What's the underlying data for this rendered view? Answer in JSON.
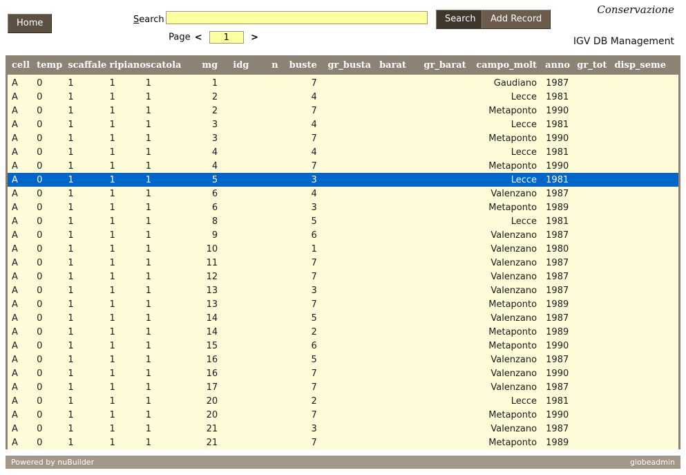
{
  "toolbar": {
    "home_label": "Home",
    "search_label_prefix": "S",
    "search_label_rest": "earch",
    "search_value": "",
    "search_placeholder": "",
    "search_button_label": "Search",
    "add_record_button_label": "Add Record"
  },
  "titles": {
    "app_title": "Conservazione",
    "subtitle": "IGV DB Management"
  },
  "pager": {
    "label": "Page",
    "prev_arrow": "<",
    "next_arrow": ">",
    "page_value": "1"
  },
  "table": {
    "columns": [
      {
        "key": "cell",
        "label": "cell",
        "align": "left"
      },
      {
        "key": "temp",
        "label": "temp",
        "align": "left"
      },
      {
        "key": "scaffale",
        "label": "scaffale",
        "align": "left"
      },
      {
        "key": "ripiano",
        "label": "ripiano",
        "align": "left"
      },
      {
        "key": "scatola",
        "label": "scatola",
        "align": "left"
      },
      {
        "key": "mg",
        "label": "mg",
        "align": "right"
      },
      {
        "key": "idg",
        "label": "idg",
        "align": "right"
      },
      {
        "key": "n",
        "label": "n",
        "align": "right"
      },
      {
        "key": "buste",
        "label": "buste",
        "align": "right"
      },
      {
        "key": "gr_busta",
        "label": "gr_busta",
        "align": "right"
      },
      {
        "key": "barat",
        "label": "barat",
        "align": "left"
      },
      {
        "key": "gr_barat",
        "label": "gr_barat",
        "align": "right"
      },
      {
        "key": "campo_molt",
        "label": "campo_molt",
        "align": "right"
      },
      {
        "key": "anno",
        "label": "anno",
        "align": "right"
      },
      {
        "key": "gr_tot",
        "label": "gr_tot",
        "align": "right"
      },
      {
        "key": "disp_seme",
        "label": "disp_seme",
        "align": "left"
      }
    ],
    "selected_row_index": 7,
    "rows": [
      {
        "cell": "A",
        "temp": "0",
        "scaffale": "1",
        "ripiano": "1",
        "scatola": "1",
        "mg": "1",
        "idg": "",
        "n": "",
        "buste": "7",
        "gr_busta": "",
        "barat": "",
        "gr_barat": "",
        "campo_molt": "Gaudiano",
        "anno": "1987",
        "gr_tot": "",
        "disp_seme": ""
      },
      {
        "cell": "A",
        "temp": "0",
        "scaffale": "1",
        "ripiano": "1",
        "scatola": "1",
        "mg": "2",
        "idg": "",
        "n": "",
        "buste": "4",
        "gr_busta": "",
        "barat": "",
        "gr_barat": "",
        "campo_molt": "Lecce",
        "anno": "1981",
        "gr_tot": "",
        "disp_seme": ""
      },
      {
        "cell": "A",
        "temp": "0",
        "scaffale": "1",
        "ripiano": "1",
        "scatola": "1",
        "mg": "2",
        "idg": "",
        "n": "",
        "buste": "7",
        "gr_busta": "",
        "barat": "",
        "gr_barat": "",
        "campo_molt": "Metaponto",
        "anno": "1990",
        "gr_tot": "",
        "disp_seme": ""
      },
      {
        "cell": "A",
        "temp": "0",
        "scaffale": "1",
        "ripiano": "1",
        "scatola": "1",
        "mg": "3",
        "idg": "",
        "n": "",
        "buste": "4",
        "gr_busta": "",
        "barat": "",
        "gr_barat": "",
        "campo_molt": "Lecce",
        "anno": "1981",
        "gr_tot": "",
        "disp_seme": ""
      },
      {
        "cell": "A",
        "temp": "0",
        "scaffale": "1",
        "ripiano": "1",
        "scatola": "1",
        "mg": "3",
        "idg": "",
        "n": "",
        "buste": "7",
        "gr_busta": "",
        "barat": "",
        "gr_barat": "",
        "campo_molt": "Metaponto",
        "anno": "1990",
        "gr_tot": "",
        "disp_seme": ""
      },
      {
        "cell": "A",
        "temp": "0",
        "scaffale": "1",
        "ripiano": "1",
        "scatola": "1",
        "mg": "4",
        "idg": "",
        "n": "",
        "buste": "4",
        "gr_busta": "",
        "barat": "",
        "gr_barat": "",
        "campo_molt": "Lecce",
        "anno": "1981",
        "gr_tot": "",
        "disp_seme": ""
      },
      {
        "cell": "A",
        "temp": "0",
        "scaffale": "1",
        "ripiano": "1",
        "scatola": "1",
        "mg": "4",
        "idg": "",
        "n": "",
        "buste": "7",
        "gr_busta": "",
        "barat": "",
        "gr_barat": "",
        "campo_molt": "Metaponto",
        "anno": "1990",
        "gr_tot": "",
        "disp_seme": ""
      },
      {
        "cell": "A",
        "temp": "0",
        "scaffale": "1",
        "ripiano": "1",
        "scatola": "1",
        "mg": "5",
        "idg": "",
        "n": "",
        "buste": "3",
        "gr_busta": "",
        "barat": "",
        "gr_barat": "",
        "campo_molt": "Lecce",
        "anno": "1981",
        "gr_tot": "",
        "disp_seme": ""
      },
      {
        "cell": "A",
        "temp": "0",
        "scaffale": "1",
        "ripiano": "1",
        "scatola": "1",
        "mg": "6",
        "idg": "",
        "n": "",
        "buste": "4",
        "gr_busta": "",
        "barat": "",
        "gr_barat": "",
        "campo_molt": "Valenzano",
        "anno": "1987",
        "gr_tot": "",
        "disp_seme": ""
      },
      {
        "cell": "A",
        "temp": "0",
        "scaffale": "1",
        "ripiano": "1",
        "scatola": "1",
        "mg": "6",
        "idg": "",
        "n": "",
        "buste": "3",
        "gr_busta": "",
        "barat": "",
        "gr_barat": "",
        "campo_molt": "Metaponto",
        "anno": "1989",
        "gr_tot": "",
        "disp_seme": ""
      },
      {
        "cell": "A",
        "temp": "0",
        "scaffale": "1",
        "ripiano": "1",
        "scatola": "1",
        "mg": "8",
        "idg": "",
        "n": "",
        "buste": "5",
        "gr_busta": "",
        "barat": "",
        "gr_barat": "",
        "campo_molt": "Lecce",
        "anno": "1981",
        "gr_tot": "",
        "disp_seme": ""
      },
      {
        "cell": "A",
        "temp": "0",
        "scaffale": "1",
        "ripiano": "1",
        "scatola": "1",
        "mg": "9",
        "idg": "",
        "n": "",
        "buste": "6",
        "gr_busta": "",
        "barat": "",
        "gr_barat": "",
        "campo_molt": "Valenzano",
        "anno": "1987",
        "gr_tot": "",
        "disp_seme": ""
      },
      {
        "cell": "A",
        "temp": "0",
        "scaffale": "1",
        "ripiano": "1",
        "scatola": "1",
        "mg": "10",
        "idg": "",
        "n": "",
        "buste": "1",
        "gr_busta": "",
        "barat": "",
        "gr_barat": "",
        "campo_molt": "Valenzano",
        "anno": "1980",
        "gr_tot": "",
        "disp_seme": ""
      },
      {
        "cell": "A",
        "temp": "0",
        "scaffale": "1",
        "ripiano": "1",
        "scatola": "1",
        "mg": "11",
        "idg": "",
        "n": "",
        "buste": "7",
        "gr_busta": "",
        "barat": "",
        "gr_barat": "",
        "campo_molt": "Valenzano",
        "anno": "1987",
        "gr_tot": "",
        "disp_seme": ""
      },
      {
        "cell": "A",
        "temp": "0",
        "scaffale": "1",
        "ripiano": "1",
        "scatola": "1",
        "mg": "12",
        "idg": "",
        "n": "",
        "buste": "7",
        "gr_busta": "",
        "barat": "",
        "gr_barat": "",
        "campo_molt": "Valenzano",
        "anno": "1987",
        "gr_tot": "",
        "disp_seme": ""
      },
      {
        "cell": "A",
        "temp": "0",
        "scaffale": "1",
        "ripiano": "1",
        "scatola": "1",
        "mg": "13",
        "idg": "",
        "n": "",
        "buste": "3",
        "gr_busta": "",
        "barat": "",
        "gr_barat": "",
        "campo_molt": "Valenzano",
        "anno": "1987",
        "gr_tot": "",
        "disp_seme": ""
      },
      {
        "cell": "A",
        "temp": "0",
        "scaffale": "1",
        "ripiano": "1",
        "scatola": "1",
        "mg": "13",
        "idg": "",
        "n": "",
        "buste": "7",
        "gr_busta": "",
        "barat": "",
        "gr_barat": "",
        "campo_molt": "Metaponto",
        "anno": "1989",
        "gr_tot": "",
        "disp_seme": ""
      },
      {
        "cell": "A",
        "temp": "0",
        "scaffale": "1",
        "ripiano": "1",
        "scatola": "1",
        "mg": "14",
        "idg": "",
        "n": "",
        "buste": "5",
        "gr_busta": "",
        "barat": "",
        "gr_barat": "",
        "campo_molt": "Valenzano",
        "anno": "1987",
        "gr_tot": "",
        "disp_seme": ""
      },
      {
        "cell": "A",
        "temp": "0",
        "scaffale": "1",
        "ripiano": "1",
        "scatola": "1",
        "mg": "14",
        "idg": "",
        "n": "",
        "buste": "2",
        "gr_busta": "",
        "barat": "",
        "gr_barat": "",
        "campo_molt": "Metaponto",
        "anno": "1989",
        "gr_tot": "",
        "disp_seme": ""
      },
      {
        "cell": "A",
        "temp": "0",
        "scaffale": "1",
        "ripiano": "1",
        "scatola": "1",
        "mg": "15",
        "idg": "",
        "n": "",
        "buste": "6",
        "gr_busta": "",
        "barat": "",
        "gr_barat": "",
        "campo_molt": "Metaponto",
        "anno": "1990",
        "gr_tot": "",
        "disp_seme": ""
      },
      {
        "cell": "A",
        "temp": "0",
        "scaffale": "1",
        "ripiano": "1",
        "scatola": "1",
        "mg": "16",
        "idg": "",
        "n": "",
        "buste": "5",
        "gr_busta": "",
        "barat": "",
        "gr_barat": "",
        "campo_molt": "Valenzano",
        "anno": "1987",
        "gr_tot": "",
        "disp_seme": ""
      },
      {
        "cell": "A",
        "temp": "0",
        "scaffale": "1",
        "ripiano": "1",
        "scatola": "1",
        "mg": "16",
        "idg": "",
        "n": "",
        "buste": "7",
        "gr_busta": "",
        "barat": "",
        "gr_barat": "",
        "campo_molt": "Valenzano",
        "anno": "1990",
        "gr_tot": "",
        "disp_seme": ""
      },
      {
        "cell": "A",
        "temp": "0",
        "scaffale": "1",
        "ripiano": "1",
        "scatola": "1",
        "mg": "17",
        "idg": "",
        "n": "",
        "buste": "7",
        "gr_busta": "",
        "barat": "",
        "gr_barat": "",
        "campo_molt": "Valenzano",
        "anno": "1987",
        "gr_tot": "",
        "disp_seme": ""
      },
      {
        "cell": "A",
        "temp": "0",
        "scaffale": "1",
        "ripiano": "1",
        "scatola": "1",
        "mg": "20",
        "idg": "",
        "n": "",
        "buste": "2",
        "gr_busta": "",
        "barat": "",
        "gr_barat": "",
        "campo_molt": "Lecce",
        "anno": "1981",
        "gr_tot": "",
        "disp_seme": ""
      },
      {
        "cell": "A",
        "temp": "0",
        "scaffale": "1",
        "ripiano": "1",
        "scatola": "1",
        "mg": "20",
        "idg": "",
        "n": "",
        "buste": "7",
        "gr_busta": "",
        "barat": "",
        "gr_barat": "",
        "campo_molt": "Metaponto",
        "anno": "1990",
        "gr_tot": "",
        "disp_seme": ""
      },
      {
        "cell": "A",
        "temp": "0",
        "scaffale": "1",
        "ripiano": "1",
        "scatola": "1",
        "mg": "21",
        "idg": "",
        "n": "",
        "buste": "3",
        "gr_busta": "",
        "barat": "",
        "gr_barat": "",
        "campo_molt": "Valenzano",
        "anno": "1987",
        "gr_tot": "",
        "disp_seme": ""
      },
      {
        "cell": "A",
        "temp": "0",
        "scaffale": "1",
        "ripiano": "1",
        "scatola": "1",
        "mg": "21",
        "idg": "",
        "n": "",
        "buste": "7",
        "gr_busta": "",
        "barat": "",
        "gr_barat": "",
        "campo_molt": "Metaponto",
        "anno": "1989",
        "gr_tot": "",
        "disp_seme": ""
      }
    ]
  },
  "footer": {
    "powered_by": "Powered by nuBuilder",
    "user": "globeadmin"
  },
  "colors": {
    "header_bar": "#8c8375",
    "row_bg": "#fdfbd8",
    "selected_row": "#0066cc",
    "button_brown": "#5c5043",
    "input_yellow": "#ffffa0",
    "footer_bar": "#a29789"
  }
}
